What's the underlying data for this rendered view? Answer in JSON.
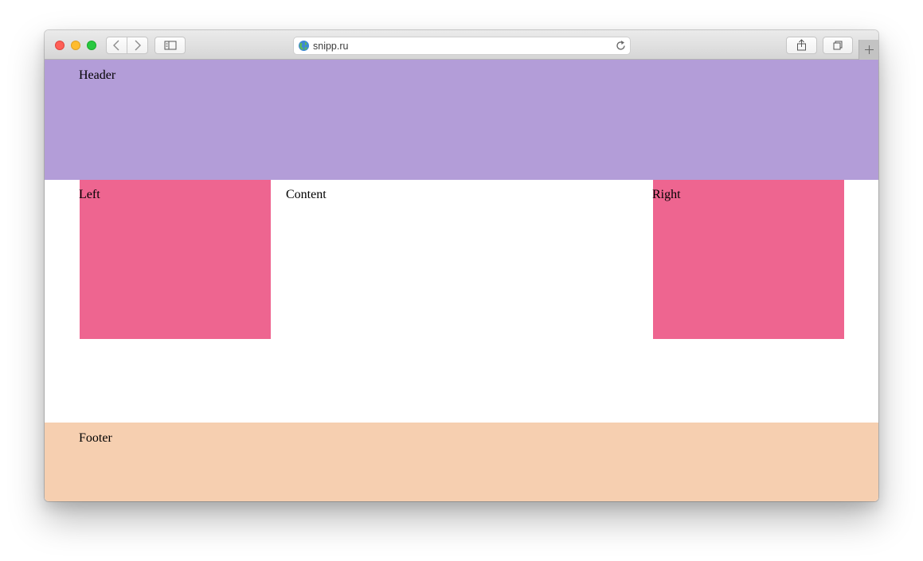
{
  "browser": {
    "url": "snipp.ru",
    "icons": [
      "close-icon",
      "minimize-icon",
      "zoom-icon",
      "back-icon",
      "forward-icon",
      "sidebar-icon",
      "globe-icon",
      "reload-icon",
      "share-icon",
      "tabs-icon",
      "plus-icon"
    ]
  },
  "page": {
    "header": {
      "label": "Header",
      "color": "#b39dd8"
    },
    "left": {
      "label": "Left",
      "color": "#ee6590"
    },
    "content": {
      "label": "Content"
    },
    "right": {
      "label": "Right",
      "color": "#ee6590"
    },
    "footer": {
      "label": "Footer",
      "color": "#f6cfb0"
    }
  }
}
